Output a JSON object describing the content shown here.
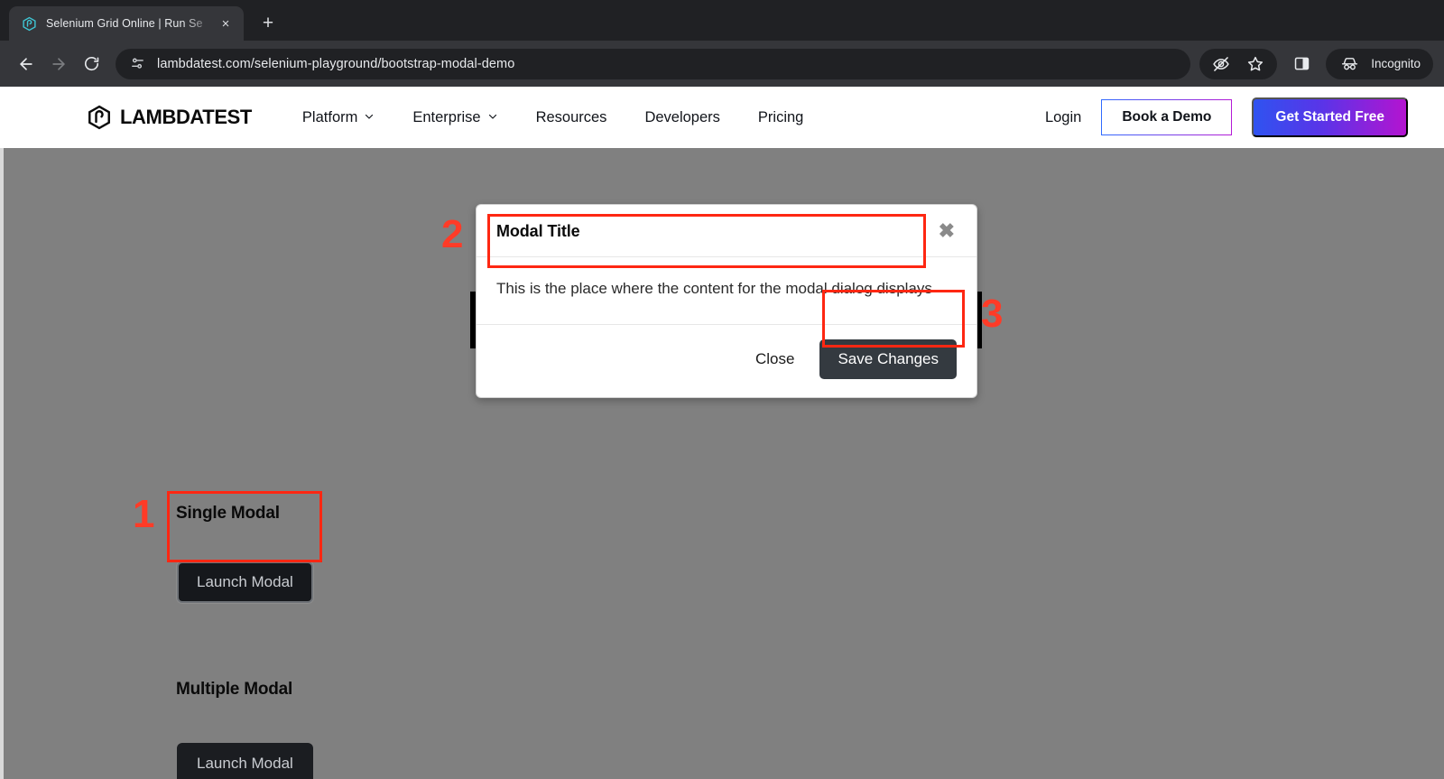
{
  "browser": {
    "tab": {
      "favicon": "lambdatest-logo-icon",
      "title": "Selenium Grid Online | Run Se",
      "close_label": "×"
    },
    "newtab_label": "+",
    "nav": {
      "back": "back-arrow-icon",
      "forward": "forward-arrow-icon",
      "reload": "reload-icon"
    },
    "omnibox": {
      "site_info_icon": "page-info-icon",
      "url": "lambdatest.com/selenium-playground/bootstrap-modal-demo"
    },
    "toolbar_right": {
      "tracking_protection_icon": "eye-slash-icon",
      "bookmark_icon": "star-icon",
      "side_panel_icon": "split-panel-icon",
      "incognito_icon": "incognito-hat-icon",
      "incognito_label": "Incognito"
    }
  },
  "site_header": {
    "logo_text": "LAMBDATEST",
    "nav_items": [
      {
        "label": "Platform",
        "has_dropdown": true
      },
      {
        "label": "Enterprise",
        "has_dropdown": true
      },
      {
        "label": "Resources",
        "has_dropdown": false
      },
      {
        "label": "Developers",
        "has_dropdown": false
      },
      {
        "label": "Pricing",
        "has_dropdown": false
      }
    ],
    "login_label": "Login",
    "demo_button": "Book a Demo",
    "free_button": "Get Started Free"
  },
  "page": {
    "single_modal_title": "Single Modal",
    "single_modal_button": "Launch Modal",
    "multiple_modal_title": "Multiple Modal",
    "multiple_modal_button": "Launch Modal"
  },
  "modal": {
    "title": "Modal Title",
    "close_icon": "✖",
    "body_text": "This is the place where the content for the modal dialog displays",
    "close_button": "Close",
    "save_button": "Save Changes"
  },
  "annotations": [
    {
      "number": "1",
      "target": "launch-modal-single-button"
    },
    {
      "number": "2",
      "target": "modal-body-text"
    },
    {
      "number": "3",
      "target": "modal-save-changes-button"
    }
  ],
  "colors": {
    "annotation_red": "#fe2712",
    "backdrop": "#808080",
    "brand_gradient_start": "#2f53f0",
    "brand_gradient_end": "#b414d0",
    "dark_button": "#1b1d21",
    "modal_save_button": "#343a40"
  }
}
